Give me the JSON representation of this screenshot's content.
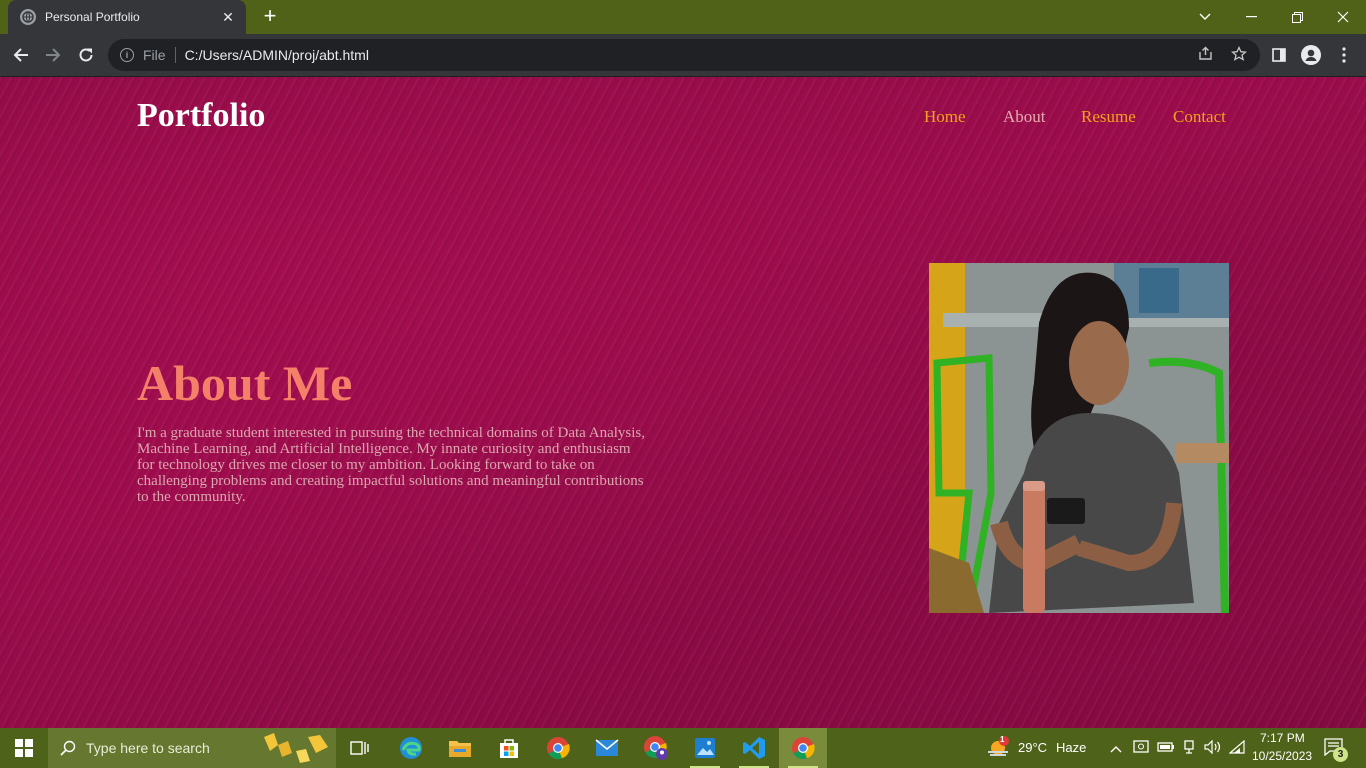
{
  "browser": {
    "tab_title": "Personal Portfolio",
    "scheme_label": "File",
    "url": "C:/Users/ADMIN/proj/abt.html"
  },
  "page": {
    "logo": "Portfolio",
    "nav": [
      "Home",
      "About",
      "Resume",
      "Contact"
    ],
    "heading": "About Me",
    "paragraph": "I'm a graduate student interested in pursuing the technical domains of Data Analysis, Machine Learning, and Artificial Intelligence. My innate curiosity and enthusiasm for technology drives me closer to my ambition. Looking forward to take on challenging problems and creating impactful solutions and meaningful contributions to the community."
  },
  "taskbar": {
    "search_placeholder": "Type here to search",
    "weather_temp": "29°C",
    "weather_desc": "Haze",
    "weather_badge": "1",
    "time": "7:17 PM",
    "date": "10/25/2023",
    "notification_count": "3"
  },
  "colors": {
    "tabstrip": "#4f6217",
    "page_bg": "#8f0b46",
    "nav_accent": "#f3a21c",
    "heading": "#f4806a"
  }
}
